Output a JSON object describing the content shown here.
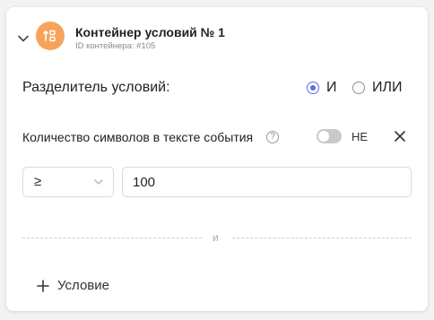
{
  "container": {
    "title": "Контейнер условий № 1",
    "id_text": "ID контейнера: #105",
    "badge_color": "#f7a35b",
    "badge_icon": "sort-conditions-icon"
  },
  "separator": {
    "label": "Разделитель условий:",
    "options": [
      {
        "label": "И",
        "selected": true
      },
      {
        "label": "ИЛИ",
        "selected": false
      }
    ],
    "accent_color": "#5b6ee1"
  },
  "condition": {
    "label": "Количество символов в тексте события",
    "help_glyph": "?",
    "negate_toggle_on": false,
    "negate_label": "НЕ",
    "operator": "≥",
    "value": "100"
  },
  "divider_label": "и",
  "add_condition_label": "Условие"
}
